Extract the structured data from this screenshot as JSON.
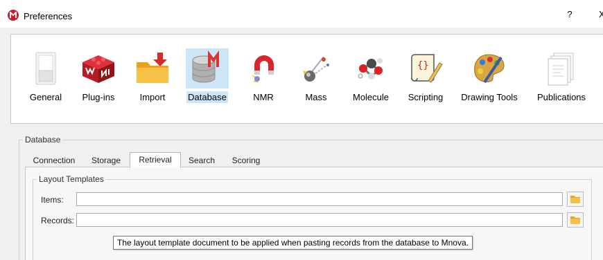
{
  "window": {
    "title": "Preferences",
    "help_label": "?",
    "close_label": "X",
    "app_icon": "mnova-logo-icon"
  },
  "categories": [
    {
      "label": "General",
      "icon": "general-switch-icon"
    },
    {
      "label": "Plug-ins",
      "icon": "plugins-cube-icon"
    },
    {
      "label": "Import",
      "icon": "import-folder-icon"
    },
    {
      "label": "Database",
      "icon": "database-icon",
      "selected": true
    },
    {
      "label": "NMR",
      "icon": "nmr-magnet-icon"
    },
    {
      "label": "Mass",
      "icon": "mass-spec-icon"
    },
    {
      "label": "Molecule",
      "icon": "molecule-icon"
    },
    {
      "label": "Scripting",
      "icon": "scripting-scroll-icon"
    },
    {
      "label": "Drawing Tools",
      "icon": "palette-icon"
    },
    {
      "label": "Publications",
      "icon": "publications-icon"
    }
  ],
  "database_group": {
    "title": "Database"
  },
  "tabs": [
    {
      "label": "Connection"
    },
    {
      "label": "Storage"
    },
    {
      "label": "Retrieval",
      "active": true
    },
    {
      "label": "Search"
    },
    {
      "label": "Scoring"
    }
  ],
  "layout_templates": {
    "title": "Layout Templates",
    "items": {
      "label": "Items:",
      "value": ""
    },
    "records": {
      "label": "Records:",
      "value": ""
    },
    "browse_icon": "folder-icon"
  },
  "tooltip": "The layout template document to be applied when pasting records from the database to Mnova.",
  "colors": {
    "selection": "#cde6f7",
    "app_red": "#c8202a",
    "folder_yellow": "#f3b62b"
  }
}
